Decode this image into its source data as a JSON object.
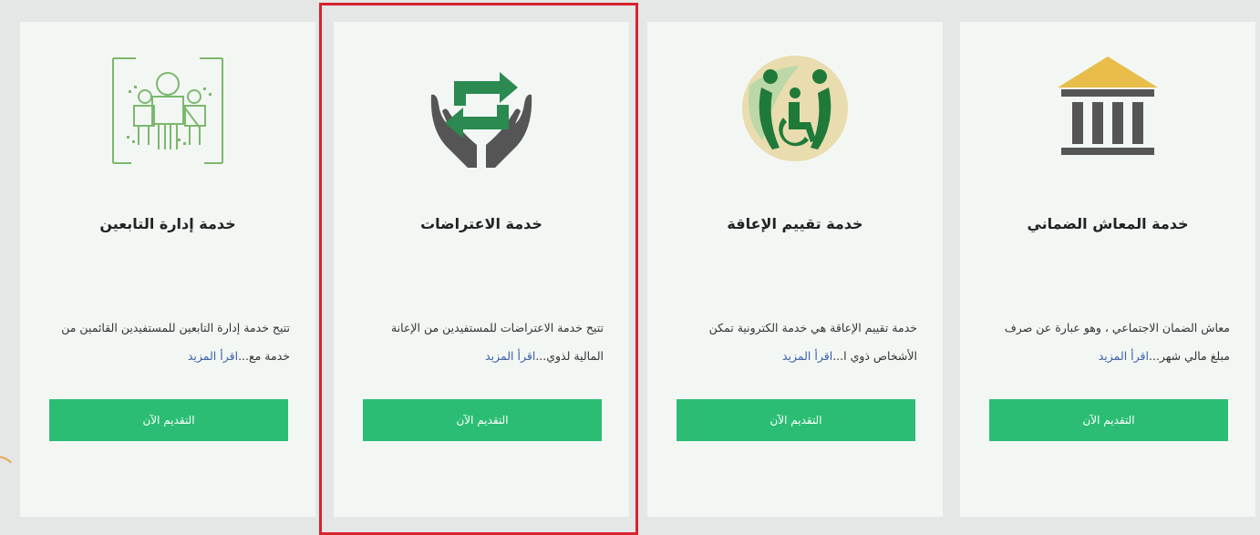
{
  "cards": [
    {
      "title": "خدمة إدارة التابعين",
      "desc": "تتيح خدمة إدارة التابعين للمستفيدين القائمين من خدمة مع...",
      "more": "اقرأ المزيد",
      "button": "التقديم الآن",
      "icon": "dependents-icon"
    },
    {
      "title": "خدمة الاعتراضات",
      "desc": "تتيح خدمة الاعتراضات للمستفيدين من الإعانة المالية لذوي...",
      "more": "اقرأ المزيد",
      "button": "التقديم الآن",
      "icon": "objection-hands-icon"
    },
    {
      "title": "خدمة تقييم الإعاقة",
      "desc": "خدمة تقييم الإعاقة هي خدمة الكترونية تمكن الأشخاص ذوي ا...",
      "more": "اقرأ المزيد",
      "button": "التقديم الآن",
      "icon": "disability-icon"
    },
    {
      "title": "خدمة المعاش الضماني",
      "desc": "معاش الضمان الاجتماعي ، وهو عبارة عن صرف مبلغ مالي شهر...",
      "more": "اقرأ المزيد",
      "button": "التقديم الآن",
      "icon": "pension-building-icon"
    }
  ],
  "colors": {
    "button": "#2bbd73",
    "highlight": "#d9232e",
    "link": "#3a5fa8"
  }
}
